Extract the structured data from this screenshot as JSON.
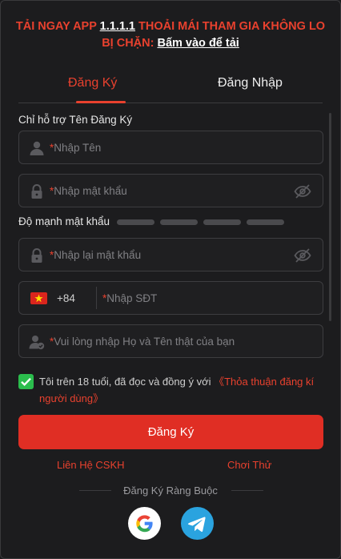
{
  "banner": {
    "prefix": "TẢI NGAY APP ",
    "version": "1.1.1.1",
    "mid": " THOẢI MÁI THAM GIA KHÔNG LO BỊ CHẶN: ",
    "link": "Bấm vào để tải"
  },
  "tabs": [
    {
      "label": "Đăng Ký",
      "active": true
    },
    {
      "label": "Đăng Nhập",
      "active": false
    }
  ],
  "form": {
    "username_hint": "Chỉ hỗ trợ Tên Đăng Ký",
    "username_placeholder": "Nhập Tên",
    "password_placeholder": "Nhập mật khẩu",
    "strength_label": "Độ mạnh mật khẩu",
    "confirm_placeholder": "Nhập lại mật khẩu",
    "phone_code": "+84",
    "phone_placeholder": "Nhập SĐT",
    "realname_placeholder": "Vui lòng nhập Họ và Tên thật của bạn",
    "required_mark": "*"
  },
  "agree": {
    "checked": true,
    "text": "Tôi trên 18 tuổi, đã đọc và đồng ý với ",
    "link": "《Thỏa thuận đăng kí người dùng》"
  },
  "submit_label": "Đăng Ký",
  "links": {
    "support": "Liên Hệ CSKH",
    "demo": "Chơi Thử"
  },
  "bind_label": "Đăng Ký Ràng Buộc",
  "colors": {
    "accent": "#e8412e",
    "button": "#e02e24",
    "check": "#2bbd4d",
    "telegram": "#2aa3df"
  }
}
